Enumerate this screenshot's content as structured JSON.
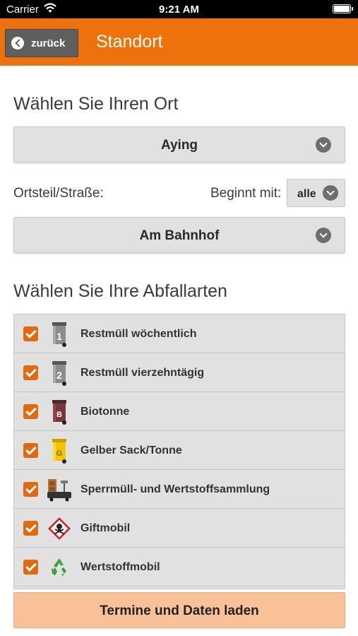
{
  "status_bar": {
    "carrier": "Carrier",
    "time": "9:21 AM"
  },
  "nav": {
    "back_label": "zurück",
    "title": "Standort"
  },
  "location": {
    "heading": "Wählen Sie Ihren Ort",
    "selected_place": "Aying",
    "street_label": "Ortsteil/Straße:",
    "filter_label": "Beginnt mit:",
    "filter_value": "alle",
    "selected_street": "Am Bahnhof"
  },
  "waste": {
    "heading": "Wählen Sie Ihre Abfallarten",
    "items": [
      {
        "label": "Restmüll wöchentlich",
        "checked": true,
        "icon": "residual-bin-1-icon"
      },
      {
        "label": "Restmüll vierzehntägig",
        "checked": true,
        "icon": "residual-bin-2-icon"
      },
      {
        "label": "Biotonne",
        "checked": true,
        "icon": "bio-bin-icon"
      },
      {
        "label": "Gelber Sack/Tonne",
        "checked": true,
        "icon": "yellow-bin-icon"
      },
      {
        "label": "Sperrmüll- und Wertstoffsammlung",
        "checked": true,
        "icon": "bulky-waste-icon"
      },
      {
        "label": "Giftmobil",
        "checked": true,
        "icon": "hazard-icon"
      },
      {
        "label": "Wertstoffmobil",
        "checked": true,
        "icon": "recycling-icon"
      }
    ]
  },
  "actions": {
    "load_label": "Termine und Daten laden"
  },
  "colors": {
    "accent": "#ee720c",
    "checkbox": "#e06a10",
    "load_button": "#f9c197"
  }
}
